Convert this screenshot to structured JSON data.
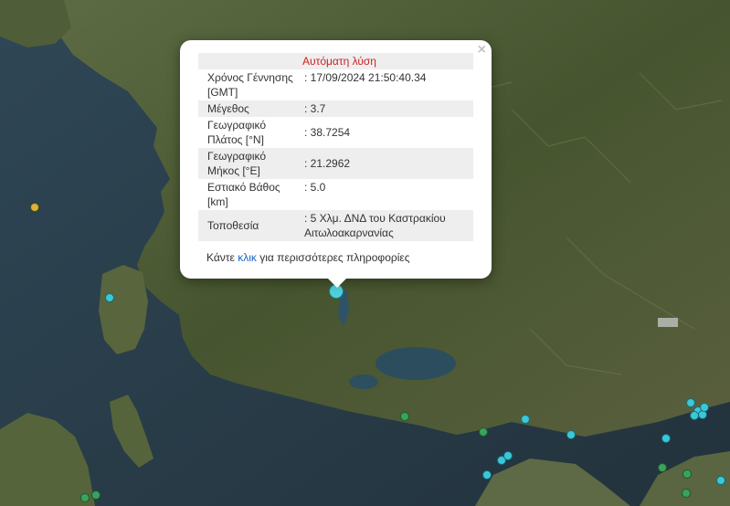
{
  "popup": {
    "header": "Αυτόματη λύση",
    "close_label": "×",
    "rows": [
      {
        "label": "Χρόνος Γέννησης [GMT]",
        "value": ": 17/09/2024 21:50:40.34"
      },
      {
        "label": "Μέγεθος",
        "value": ": 3.7"
      },
      {
        "label": "Γεωγραφικό Πλάτος [°N]",
        "value": ": 38.7254"
      },
      {
        "label": "Γεωγραφικό Μήκος [°E]",
        "value": ": 21.2962"
      },
      {
        "label": "Εστιακό Βάθος [km]",
        "value": ": 5.0"
      },
      {
        "label": "Τοποθεσία",
        "value": ": 5 Χλμ. ΔΝΔ του Καστρακίου Αιτωλοακαρνανίας"
      }
    ],
    "more_prefix": "Κάντε ",
    "more_link": "κλικ",
    "more_suffix": " για περισσότερες πληροφορίες"
  },
  "colors": {
    "selected_quake": "#4fd1dc",
    "recent_quake": "#3cc7d8",
    "older_quake": "#3aa35b",
    "oldest_quake": "#d9b43a",
    "sea": "#2b3f4a",
    "land": "#4a5a36"
  }
}
